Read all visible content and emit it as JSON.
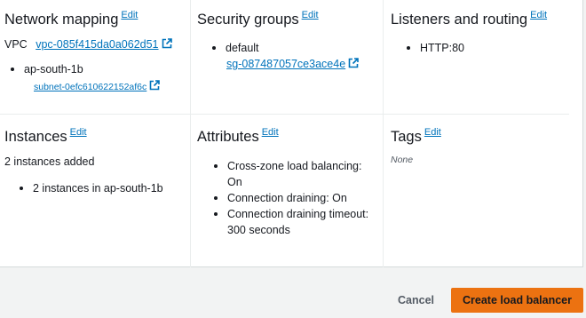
{
  "network_mapping": {
    "title": "Network mapping",
    "edit": "Edit",
    "vpc_label": "VPC",
    "vpc_id": "vpc-085f415da0a062d51",
    "az": "ap-south-1b",
    "subnet_id": "subnet-0efc610622152af6c"
  },
  "security_groups": {
    "title": "Security groups",
    "edit": "Edit",
    "group_name": "default",
    "group_id": "sg-087487057ce3ace4e"
  },
  "listeners": {
    "title": "Listeners and routing",
    "edit": "Edit",
    "items": [
      "HTTP:80"
    ]
  },
  "instances": {
    "title": "Instances",
    "edit": "Edit",
    "summary": "2 instances added",
    "items": [
      "2 instances in ap-south-1b"
    ]
  },
  "attributes": {
    "title": "Attributes",
    "edit": "Edit",
    "items": [
      "Cross-zone load balancing: On",
      "Connection draining: On",
      "Connection draining timeout:",
      "300 seconds"
    ]
  },
  "tags": {
    "title": "Tags",
    "edit": "Edit",
    "empty": "None"
  },
  "footer": {
    "cancel": "Cancel",
    "create": "Create load balancer"
  },
  "icons": {
    "external": "external-link-icon"
  },
  "colors": {
    "link": "#0073bb",
    "primary_button": "#ec7211",
    "page_bg": "#f2f3f3"
  }
}
